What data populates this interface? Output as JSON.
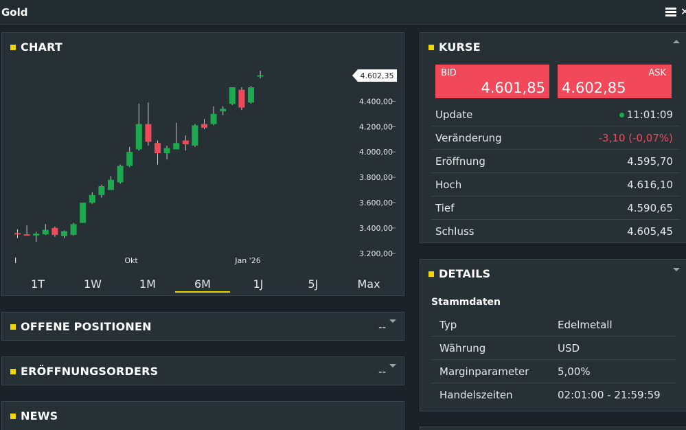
{
  "window": {
    "title": "Gold"
  },
  "chart_panel": {
    "title": "CHART",
    "price_tag": "4.602,35",
    "ranges": [
      "1T",
      "1W",
      "1M",
      "6M",
      "1J",
      "5J",
      "Max"
    ],
    "active_range": "6M"
  },
  "chart_data": {
    "type": "candlestick",
    "ylim": [
      3150,
      4700
    ],
    "y_ticks": [
      {
        "value": 3200,
        "label": "3.200,00"
      },
      {
        "value": 3400,
        "label": "3.400,00"
      },
      {
        "value": 3600,
        "label": "3.600,00"
      },
      {
        "value": 3800,
        "label": "3.800,00"
      },
      {
        "value": 4000,
        "label": "4.000,00"
      },
      {
        "value": 4200,
        "label": "4.200,00"
      },
      {
        "value": 4400,
        "label": "4.400,00"
      }
    ],
    "x_ticks": [
      {
        "index": 0,
        "label": "I"
      },
      {
        "index": 12.5,
        "label": "Okt"
      },
      {
        "index": 25,
        "label": "Jan '26"
      }
    ],
    "last_price": 4602.35,
    "candles": [
      {
        "o": 3360,
        "h": 3390,
        "l": 3320,
        "c": 3350
      },
      {
        "o": 3350,
        "h": 3420,
        "l": 3340,
        "c": 3345
      },
      {
        "o": 3340,
        "h": 3370,
        "l": 3290,
        "c": 3355
      },
      {
        "o": 3350,
        "h": 3430,
        "l": 3345,
        "c": 3385
      },
      {
        "o": 3400,
        "h": 3410,
        "l": 3330,
        "c": 3345
      },
      {
        "o": 3335,
        "h": 3380,
        "l": 3320,
        "c": 3375
      },
      {
        "o": 3345,
        "h": 3440,
        "l": 3340,
        "c": 3430
      },
      {
        "o": 3440,
        "h": 3600,
        "l": 3440,
        "c": 3600
      },
      {
        "o": 3600,
        "h": 3680,
        "l": 3590,
        "c": 3660
      },
      {
        "o": 3660,
        "h": 3740,
        "l": 3640,
        "c": 3730
      },
      {
        "o": 3700,
        "h": 3810,
        "l": 3700,
        "c": 3780
      },
      {
        "o": 3760,
        "h": 3900,
        "l": 3750,
        "c": 3890
      },
      {
        "o": 3890,
        "h": 4040,
        "l": 3880,
        "c": 4000
      },
      {
        "o": 4020,
        "h": 4380,
        "l": 4010,
        "c": 4220
      },
      {
        "o": 4220,
        "h": 4390,
        "l": 4050,
        "c": 4080
      },
      {
        "o": 4070,
        "h": 4090,
        "l": 3900,
        "c": 3990
      },
      {
        "o": 3990,
        "h": 4050,
        "l": 3940,
        "c": 4030
      },
      {
        "o": 4020,
        "h": 4230,
        "l": 4020,
        "c": 4070
      },
      {
        "o": 4090,
        "h": 4130,
        "l": 4010,
        "c": 4060
      },
      {
        "o": 4050,
        "h": 4220,
        "l": 4040,
        "c": 4210
      },
      {
        "o": 4220,
        "h": 4260,
        "l": 4180,
        "c": 4190
      },
      {
        "o": 4220,
        "h": 4360,
        "l": 4210,
        "c": 4300
      },
      {
        "o": 4320,
        "h": 4360,
        "l": 4290,
        "c": 4340
      },
      {
        "o": 4380,
        "h": 4510,
        "l": 4370,
        "c": 4510
      },
      {
        "o": 4490,
        "h": 4510,
        "l": 4330,
        "c": 4350
      },
      {
        "o": 4390,
        "h": 4520,
        "l": 4380,
        "c": 4510
      },
      {
        "o": 4600,
        "h": 4640,
        "l": 4580,
        "c": 4605
      }
    ]
  },
  "positions_panel": {
    "title": "OFFENE POSITIONEN",
    "value": "--"
  },
  "orders_panel": {
    "title": "ERÖFFNUNGSORDERS",
    "value": "--"
  },
  "news_panel": {
    "title": "NEWS"
  },
  "kurse_panel": {
    "title": "KURSE",
    "bid_label": "BID",
    "bid_value": "4.601,85",
    "ask_label": "ASK",
    "ask_value": "4.602,85",
    "rows": [
      {
        "label": "Update",
        "value": "11:01:09"
      },
      {
        "label": "Veränderung",
        "value": "-3,10 (-0,07%)"
      },
      {
        "label": "Eröffnung",
        "value": "4.595,70"
      },
      {
        "label": "Hoch",
        "value": "4.616,10"
      },
      {
        "label": "Tief",
        "value": "4.590,65"
      },
      {
        "label": "Schluss",
        "value": "4.605,45"
      }
    ],
    "colors": {
      "bid_ask_bg": "#f2495a",
      "up": "#1ea84f",
      "down": "#f2495a"
    }
  },
  "details_panel": {
    "title": "DETAILS",
    "subtitle": "Stammdaten",
    "rows": [
      {
        "label": "Typ",
        "value": "Edelmetall"
      },
      {
        "label": "Währung",
        "value": "USD"
      },
      {
        "label": "Marginparameter",
        "value": "5,00%"
      },
      {
        "label": "Handelszeiten",
        "value": "02:01:00 - 21:59:59"
      }
    ]
  }
}
